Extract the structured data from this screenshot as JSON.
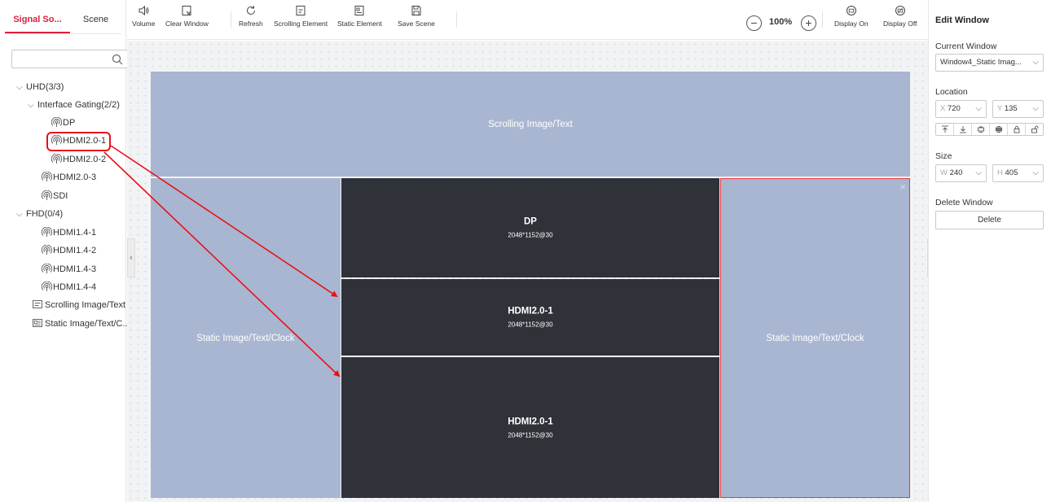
{
  "left_panel": {
    "tabs": [
      {
        "label": "Signal So...",
        "active": true
      },
      {
        "label": "Scene",
        "active": false
      }
    ],
    "search": {
      "value": "",
      "placeholder": ""
    },
    "tree": [
      {
        "label": "UHD(3/3)",
        "kind": "group"
      },
      {
        "label": "Interface Gating(2/2)",
        "kind": "group"
      },
      {
        "label": "DP",
        "kind": "signal"
      },
      {
        "label": "HDMI2.0-1",
        "kind": "signal"
      },
      {
        "label": "HDMI2.0-2",
        "kind": "signal"
      },
      {
        "label": "HDMI2.0-3",
        "kind": "signal"
      },
      {
        "label": "SDI",
        "kind": "signal"
      },
      {
        "label": "FHD(0/4)",
        "kind": "group"
      },
      {
        "label": "HDMI1.4-1",
        "kind": "signal"
      },
      {
        "label": "HDMI1.4-2",
        "kind": "signal"
      },
      {
        "label": "HDMI1.4-3",
        "kind": "signal"
      },
      {
        "label": "HDMI1.4-4",
        "kind": "signal"
      },
      {
        "label": "Scrolling Image/Text",
        "kind": "element"
      },
      {
        "label": "Static Image/Text/C...",
        "kind": "element"
      }
    ]
  },
  "toolbar": {
    "buttons": [
      {
        "label": "Volume",
        "icon": "volume-icon"
      },
      {
        "label": "Clear Window",
        "icon": "clear-window-icon"
      },
      {
        "label": "Refresh",
        "icon": "refresh-icon"
      },
      {
        "label": "Scrolling Element",
        "icon": "scrolling-element-icon"
      },
      {
        "label": "Static Element",
        "icon": "static-element-icon"
      },
      {
        "label": "Save Scene",
        "icon": "save-icon"
      },
      {
        "label": "Display On",
        "icon": "display-on-icon"
      },
      {
        "label": "Display Off",
        "icon": "display-off-icon"
      }
    ],
    "zoom": {
      "value": "100%",
      "minus": "−",
      "plus": "+"
    }
  },
  "canvas": {
    "windows": [
      {
        "label": "Scrolling Image/Text",
        "style": "light"
      },
      {
        "label": "Static Image/Text/Clock",
        "style": "light"
      },
      {
        "name": "DP",
        "resolution": "2048*1152@30",
        "style": "dark"
      },
      {
        "name": "HDMI2.0-1",
        "resolution": "2048*1152@30",
        "style": "dark"
      },
      {
        "name": "HDMI2.0-1",
        "resolution": "2048*1152@30",
        "style": "dark"
      },
      {
        "label": "Static Image/Text/Clock",
        "style": "light",
        "selected": true
      }
    ],
    "close_glyph": "×",
    "collapse_left": "‹",
    "collapse_right": "›"
  },
  "right_panel": {
    "title": "Edit Window",
    "current_window": {
      "label": "Current Window",
      "value": "Window4_Static Imag..."
    },
    "location": {
      "label": "Location",
      "x_prefix": "X",
      "x": "720",
      "y_prefix": "Y",
      "y": "135"
    },
    "size": {
      "label": "Size",
      "w_prefix": "W",
      "w": "240",
      "h_prefix": "H",
      "h": "405"
    },
    "delete": {
      "label": "Delete Window",
      "button": "Delete"
    },
    "dropdown_glyph": "⌵"
  },
  "colors": {
    "accent": "#e0203a",
    "window_light": "#a9b6d1",
    "window_dark": "#2f3238",
    "annotation": "#e8101a"
  }
}
